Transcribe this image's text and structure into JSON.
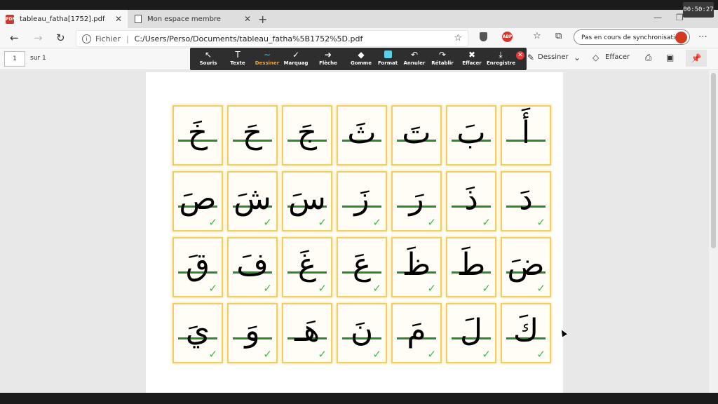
{
  "clock": "00:50:27",
  "tabs": [
    {
      "title": "tableau_fatha[1752].pdf",
      "active": true
    },
    {
      "title": "Mon espace membre",
      "active": false
    }
  ],
  "address": {
    "scheme": "Fichier",
    "path": "C:/Users/Perso/Documents/tableau_fatha%5B1752%5D.pdf"
  },
  "sync_label": "Pas en cours de synchronisation",
  "pdf_toolbar": {
    "page": "1",
    "of_label": "sur 1",
    "draw_label": "Dessiner",
    "erase_label": "Effacer"
  },
  "draw_tools": [
    {
      "label": "Souris",
      "icon": "cursor-icon",
      "glyph": "↖"
    },
    {
      "label": "Texte",
      "icon": "text-icon",
      "glyph": "T"
    },
    {
      "label": "Dessiner",
      "icon": "pen-icon",
      "glyph": "∼",
      "selected": true
    },
    {
      "label": "Marquag",
      "icon": "checkmark-icon",
      "glyph": "✓"
    },
    {
      "label": "Flèche",
      "icon": "arrow-icon",
      "glyph": "➜"
    },
    {
      "label": "Gomme",
      "icon": "eraser-icon",
      "glyph": "◆"
    },
    {
      "label": "Format",
      "icon": "color-swatch-icon",
      "glyph": ""
    },
    {
      "label": "Annuler",
      "icon": "undo-icon",
      "glyph": "↶"
    },
    {
      "label": "Rétablir",
      "icon": "redo-icon",
      "glyph": "↷"
    },
    {
      "label": "Effacer",
      "icon": "trash-icon",
      "glyph": "✖"
    },
    {
      "label": "Enregistre",
      "icon": "save-icon",
      "glyph": "⤓"
    }
  ],
  "letters": [
    [
      "خَ",
      "حَ",
      "جَ",
      "ثَ",
      "تَ",
      "بَ",
      "أَ"
    ],
    [
      "صَ",
      "شَ",
      "سَ",
      "زَ",
      "رَ",
      "ذَ",
      "دَ"
    ],
    [
      "قَ",
      "فَ",
      "غَ",
      "عَ",
      "ظَ",
      "طَ",
      "ضَ"
    ],
    [
      "يَ",
      "وَ",
      "هَـ",
      "نَ",
      "مَ",
      "لَ",
      "كَ"
    ]
  ],
  "checked_rows": [
    false,
    true,
    true,
    true
  ],
  "colors": {
    "line": "#2c8a2c",
    "check": "#45b845",
    "cell_border": "#f2cf63",
    "selected_tool": "#f2a33a"
  }
}
